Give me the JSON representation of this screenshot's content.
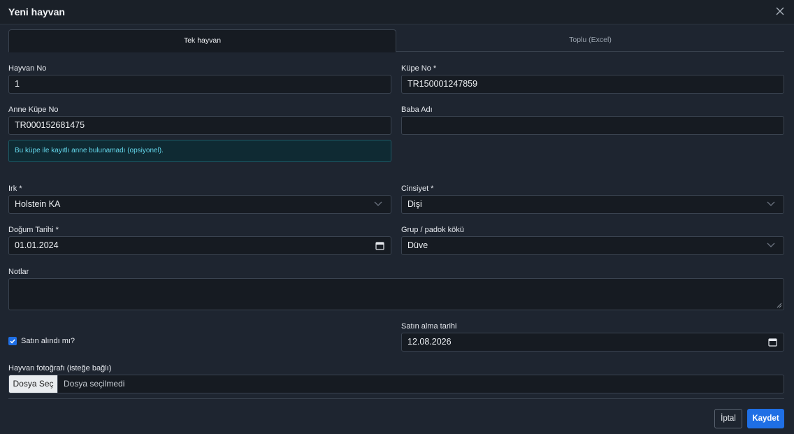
{
  "modal": {
    "title": "Yeni hayvan"
  },
  "tabs": [
    {
      "label": "Tek hayvan",
      "active": true
    },
    {
      "label": "Toplu (Excel)",
      "active": false
    }
  ],
  "form": {
    "hayvan_no": {
      "label": "Hayvan No",
      "value": "1"
    },
    "kupe_no": {
      "label": "Küpe No *",
      "value": "TR150001247859"
    },
    "anne_kupe_no": {
      "label": "Anne Küpe No",
      "value": "TR000152681475"
    },
    "baba_adi": {
      "label": "Baba Adı",
      "value": ""
    },
    "anne_alert": "Bu küpe ile kayıtlı anne bulunamadı (opsiyonel).",
    "irk": {
      "label": "Irk *",
      "value": "Holstein KA"
    },
    "cinsiyet": {
      "label": "Cinsiyet *",
      "value": "Dişi"
    },
    "dogum_tarihi": {
      "label": "Doğum Tarihi *",
      "value": "01.01.2024"
    },
    "grup": {
      "label": "Grup / padok kökü",
      "value": "Düve"
    },
    "notlar": {
      "label": "Notlar",
      "value": ""
    },
    "satin_alindi": {
      "label": "Satın alındı mı?",
      "checked": true
    },
    "satin_alma_tarihi": {
      "label": "Satın alma tarihi",
      "value": "12.08.2026"
    },
    "foto": {
      "label": "Hayvan fotoğrafı (isteğe bağlı)",
      "button": "Dosya Seç",
      "status": "Dosya seçilmedi"
    }
  },
  "footer": {
    "cancel_label": "İptal",
    "save_label": "Kaydet"
  },
  "colors": {
    "background": "#1e2530",
    "input_bg": "#161b22",
    "accent": "#1f6fe5",
    "alert_text": "#63d6ea"
  }
}
